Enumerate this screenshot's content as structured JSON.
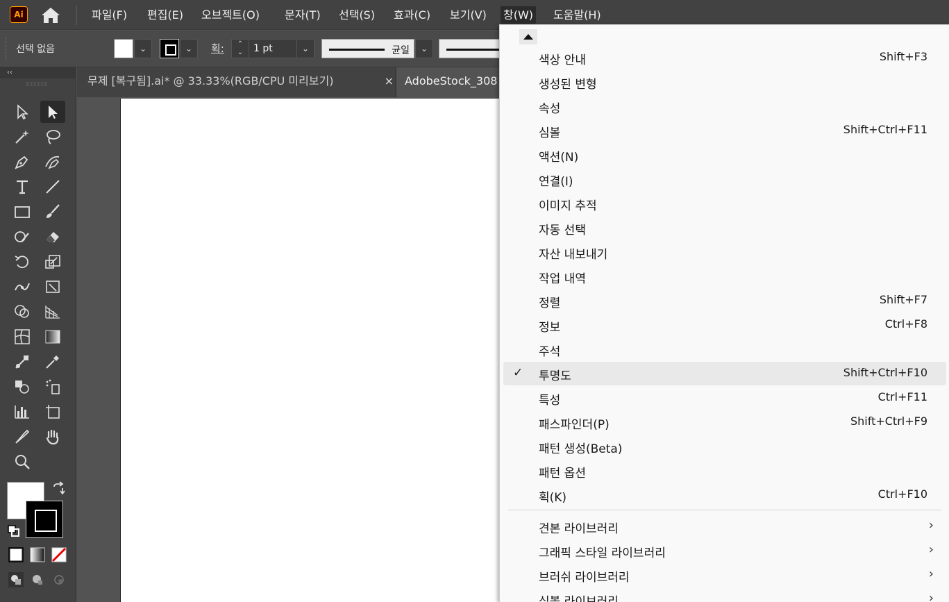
{
  "menubar": {
    "logo": "Ai",
    "items": [
      "파일(F)",
      "편집(E)",
      "오브젝트(O)",
      "문자(T)",
      "선택(S)",
      "효과(C)",
      "보기(V)",
      "창(W)",
      "도움말(H)"
    ]
  },
  "control": {
    "selection": "선택 없음",
    "stroke_label": "획:",
    "stroke_weight": "1 pt",
    "profile": "균일"
  },
  "toolpanel": {
    "collapse": "‹‹"
  },
  "tabs": [
    {
      "label": "무제 [복구됨].ai* @ 33.33%(RGB/CPU 미리보기)",
      "close": "×"
    },
    {
      "label": "AdobeStock_308"
    }
  ],
  "window_menu": {
    "items": [
      {
        "label": "색상 안내",
        "shortcut": "Shift+F3",
        "checked": false,
        "submenu": false
      },
      {
        "label": "생성된 변형",
        "shortcut": "",
        "checked": false,
        "submenu": false
      },
      {
        "label": "속성",
        "shortcut": "",
        "checked": false,
        "submenu": false
      },
      {
        "label": "심볼",
        "shortcut": "Shift+Ctrl+F11",
        "checked": false,
        "submenu": false
      },
      {
        "label": "액션(N)",
        "shortcut": "",
        "checked": false,
        "submenu": false
      },
      {
        "label": "연결(I)",
        "shortcut": "",
        "checked": false,
        "submenu": false
      },
      {
        "label": "이미지 추적",
        "shortcut": "",
        "checked": false,
        "submenu": false
      },
      {
        "label": "자동 선택",
        "shortcut": "",
        "checked": false,
        "submenu": false
      },
      {
        "label": "자산 내보내기",
        "shortcut": "",
        "checked": false,
        "submenu": false
      },
      {
        "label": "작업 내역",
        "shortcut": "",
        "checked": false,
        "submenu": false
      },
      {
        "label": "정렬",
        "shortcut": "Shift+F7",
        "checked": false,
        "submenu": false
      },
      {
        "label": "정보",
        "shortcut": "Ctrl+F8",
        "checked": false,
        "submenu": false
      },
      {
        "label": "주석",
        "shortcut": "",
        "checked": false,
        "submenu": false
      },
      {
        "label": "투명도",
        "shortcut": "Shift+Ctrl+F10",
        "checked": true,
        "submenu": false
      },
      {
        "label": "특성",
        "shortcut": "Ctrl+F11",
        "checked": false,
        "submenu": false
      },
      {
        "label": "패스파인더(P)",
        "shortcut": "Shift+Ctrl+F9",
        "checked": false,
        "submenu": false
      },
      {
        "label": "패턴 생성(Beta)",
        "shortcut": "",
        "checked": false,
        "submenu": false
      },
      {
        "label": "패턴 옵션",
        "shortcut": "",
        "checked": false,
        "submenu": false
      },
      {
        "label": "획(K)",
        "shortcut": "Ctrl+F10",
        "checked": false,
        "submenu": false
      }
    ],
    "libraries": [
      {
        "label": "견본 라이브러리",
        "submenu": true
      },
      {
        "label": "그래픽 스타일 라이브러리",
        "submenu": true
      },
      {
        "label": "브러쉬 라이브러리",
        "submenu": true
      },
      {
        "label": "심볼 라이브러리",
        "submenu": true
      }
    ],
    "check_glyph": "✓",
    "arrow_glyph": "›"
  },
  "colors": {
    "accent": "#ff9a00",
    "ui_dark": "#424242",
    "menu_bg": "#f9f9f9"
  }
}
